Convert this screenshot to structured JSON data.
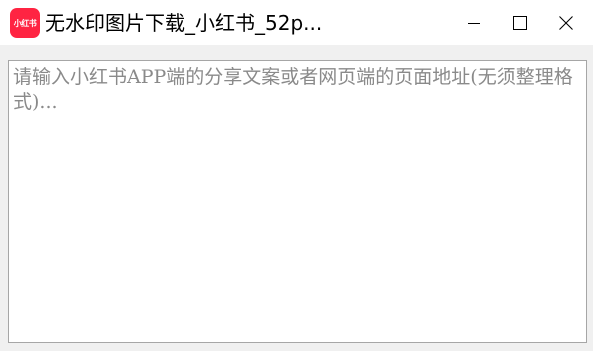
{
  "window": {
    "title": "无水印图片下载_小红书_52p...",
    "app_icon_text": "小红书",
    "brand_color": "#ff2442",
    "controls": {
      "minimize_icon": "minimize-icon",
      "maximize_icon": "maximize-icon",
      "close_icon": "close-icon"
    }
  },
  "main": {
    "input_placeholder": "请输入小红书APP端的分享文案或者网页端的页面地址(无须整理格式)...",
    "input_value": ""
  }
}
